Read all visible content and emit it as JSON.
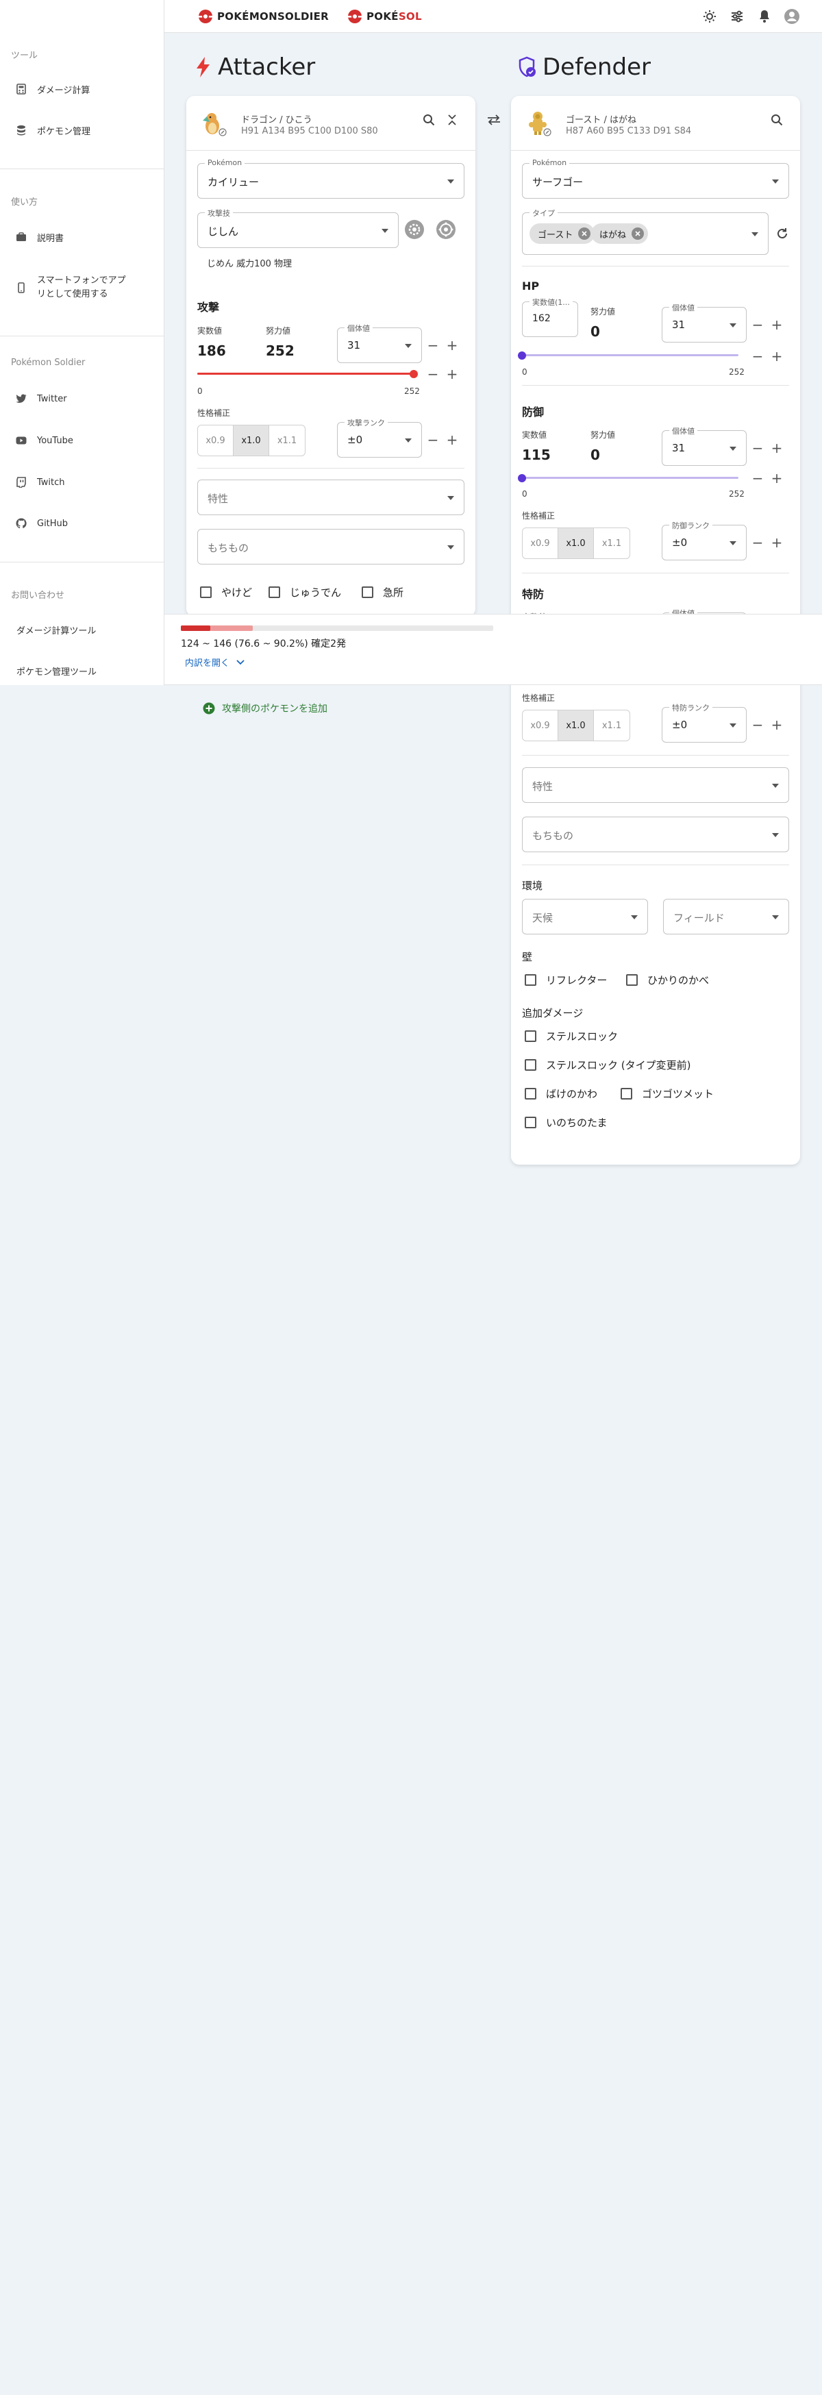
{
  "header": {
    "logo1": "POKÉMONSOLDIER",
    "logo2_a": "POKÉ",
    "logo2_b": "SOL"
  },
  "sidebar": {
    "sec_tools": "ツール",
    "damage": "ダメージ計算",
    "box": "ポケモン管理",
    "sec_usage": "使い方",
    "manual": "説明書",
    "app": "スマートフォンでアプリとして使用する",
    "sec_ps": "Pokémon Soldier",
    "twitter": "Twitter",
    "youtube": "YouTube",
    "twitch": "Twitch",
    "github": "GitHub",
    "sec_contact": "お問い合わせ",
    "contact_damage": "ダメージ計算ツール",
    "contact_box": "ポケモン管理ツール"
  },
  "attacker": {
    "title": "Attacker",
    "types": "ドラゴン / ひこう",
    "stats": "H91 A134 B95 C100 D100 S80",
    "pokemon_label": "Pokémon",
    "pokemon": "カイリュー",
    "move_label": "攻撃技",
    "move": "じしん",
    "move_note": "じめん 威力100 物理",
    "stat_title": "攻撃",
    "real_label": "実数値",
    "real": "186",
    "ev_label": "努力値",
    "ev": "252",
    "iv_label": "個体値",
    "iv": "31",
    "slider_min": "0",
    "slider_max": "252",
    "ev_fraction": 1.0,
    "nature_label": "性格補正",
    "n1": "x0.9",
    "n2": "x1.0",
    "n3": "x1.1",
    "rank_label": "攻撃ランク",
    "rank": "±0",
    "ability_ph": "特性",
    "item_ph": "もちもの",
    "burn": "やけど",
    "charge": "じゅうでん",
    "crit": "急所",
    "add": "攻撃側のポケモンを追加"
  },
  "defender": {
    "title": "Defender",
    "types": "ゴースト / はがね",
    "stats": "H87 A60 B95 C133 D91 S84",
    "pokemon_label": "Pokémon",
    "pokemon": "サーフゴー",
    "type_label": "タイプ",
    "type1": "ゴースト",
    "type2": "はがね",
    "hp_title": "HP",
    "hp_real_label": "実数値(1...",
    "hp_real": "162",
    "hp_ev_label": "努力値",
    "hp_ev": "0",
    "hp_iv_label": "個体値",
    "hp_iv": "31",
    "hp_min": "0",
    "hp_max": "252",
    "hp_ev_fraction": 0,
    "def_title": "防御",
    "def_real_label": "実数値",
    "def_real": "115",
    "def_ev_label": "努力値",
    "def_ev": "0",
    "def_iv_label": "個体値",
    "def_iv": "31",
    "def_min": "0",
    "def_max": "252",
    "def_ev_fraction": 0,
    "nature_label": "性格補正",
    "n1": "x0.9",
    "n2": "x1.0",
    "n3": "x1.1",
    "def_rank_label": "防御ランク",
    "def_rank": "±0",
    "sp_title": "特防",
    "sp_real_label": "実数値",
    "sp_iv_label": "個体値",
    "sp_nature_label": "性格補正",
    "sp_rank_label": "特防ランク",
    "sp_rank": "±0",
    "ability_ph": "特性",
    "item_ph": "もちもの",
    "env_title": "環境",
    "weather_ph": "天候",
    "field_ph": "フィールド",
    "wall_title": "壁",
    "reflect": "リフレクター",
    "light": "ひかりのかべ",
    "extra_title": "追加ダメージ",
    "sr": "ステルスロック",
    "sr2": "ステルスロック (タイプ変更前)",
    "disguise": "ばけのかわ",
    "rocky": "ゴツゴツメット",
    "orb": "いのちのたま"
  },
  "result": {
    "range": "124 ~ 146 (76.6 ~ 90.2%) 確定2発",
    "detail": "内訳を開く",
    "min_fraction": 0.095,
    "max_fraction": 0.23,
    "bar_red": "#d32f2f",
    "bar_pink": "#ef9a9a"
  }
}
